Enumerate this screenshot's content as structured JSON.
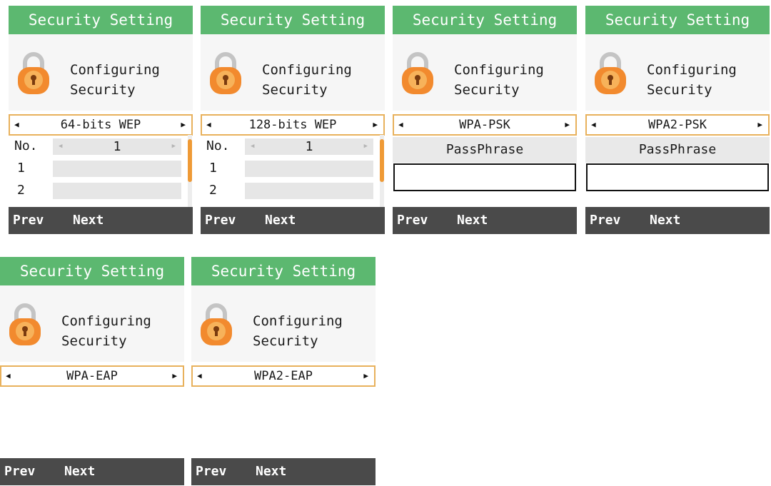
{
  "title": "Security Setting",
  "header_line1": "Configuring",
  "header_line2": "Security",
  "softkeys": {
    "prev": "Prev",
    "next": "Next"
  },
  "wep_table": {
    "no_label": "No.",
    "no_value": "1",
    "row1_label": "1",
    "row2_label": "2"
  },
  "passphrase_label": "PassPhrase",
  "selector_arrows": {
    "left": "◀",
    "right": "▶"
  },
  "screens": [
    {
      "mode": "64-bits WEP"
    },
    {
      "mode": "128-bits WEP"
    },
    {
      "mode": "WPA-PSK"
    },
    {
      "mode": "WPA2-PSK"
    },
    {
      "mode": "WPA-EAP"
    },
    {
      "mode": "WPA2-EAP"
    }
  ],
  "colors": {
    "title_bar": "#5cb870",
    "selector_border": "#e8b15c",
    "softkey_bar": "#4a4a4a",
    "scroll_thumb": "#ef9a36",
    "lock_body": "#f28a2e"
  },
  "icons": {
    "lock": "padlock-icon"
  }
}
